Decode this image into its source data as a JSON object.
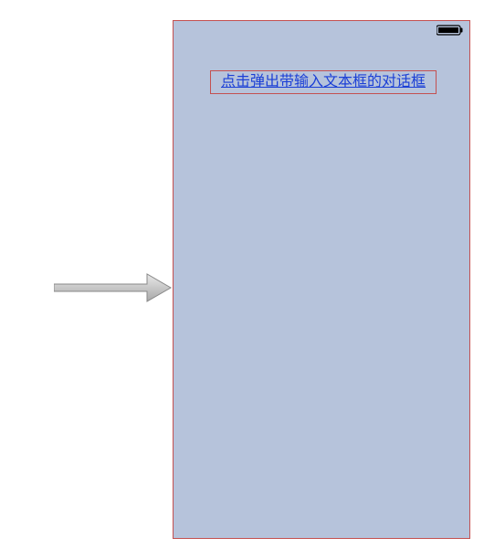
{
  "button": {
    "label": "点击弹出带输入文本框的对话框"
  }
}
